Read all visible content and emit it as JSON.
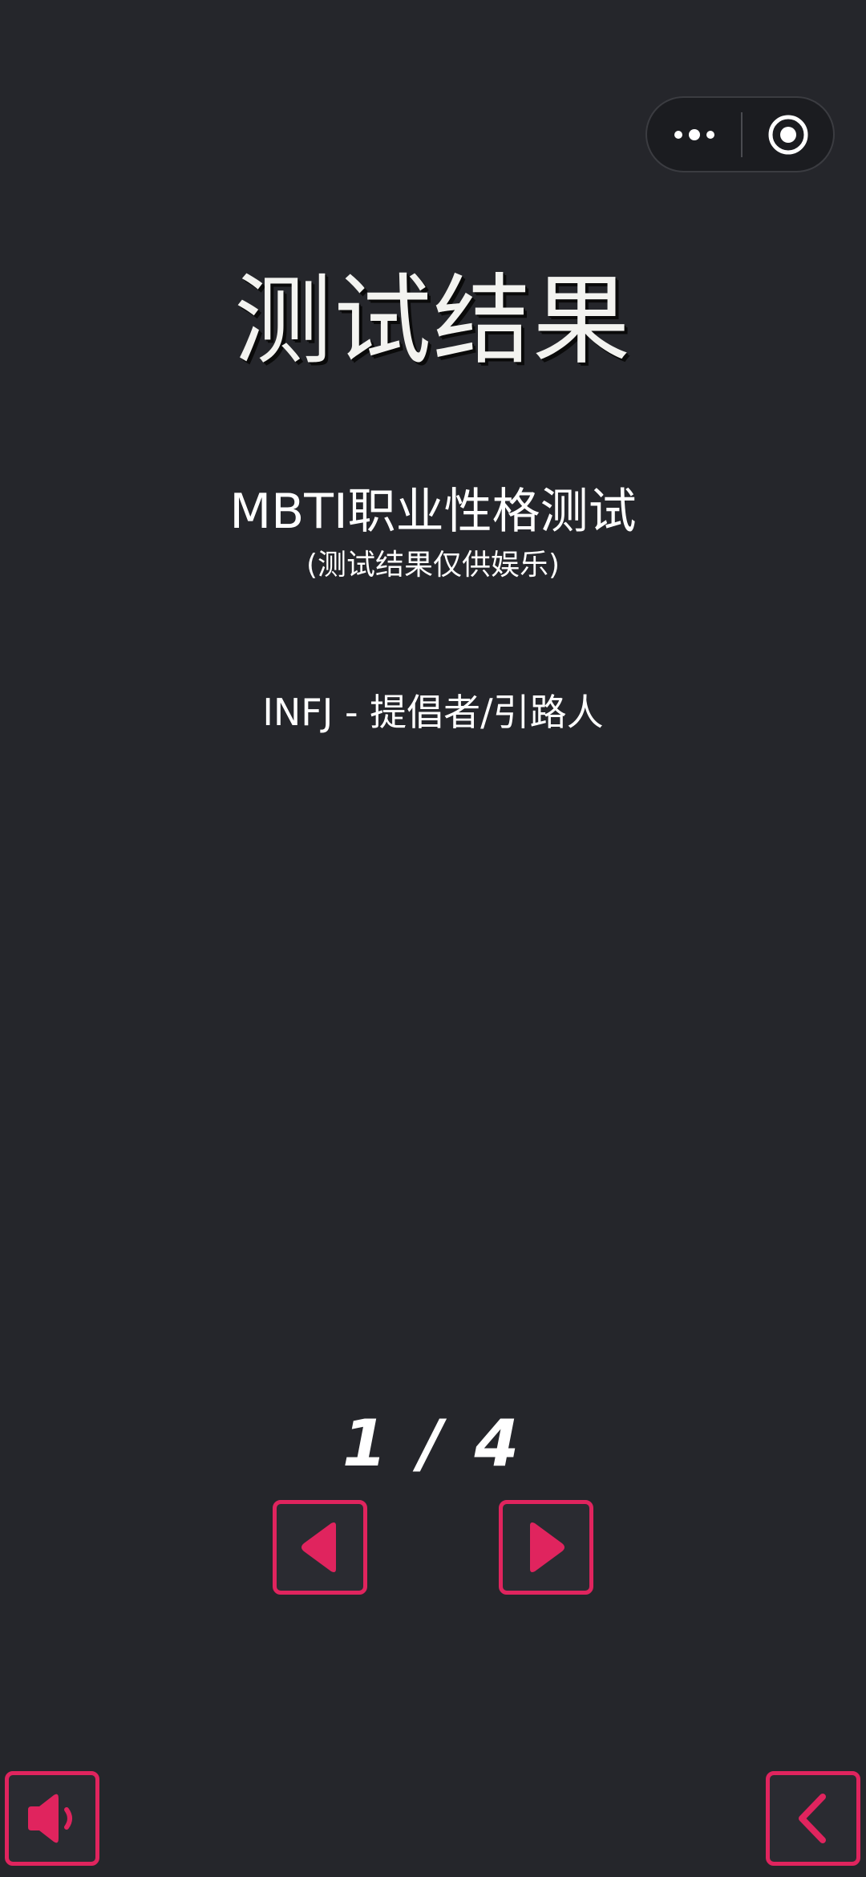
{
  "header": {
    "title": "测试结果",
    "capsule": {
      "more_icon": "more-dots-icon",
      "close_icon": "record-target-icon"
    }
  },
  "quiz": {
    "name": "MBTI职业性格测试",
    "note": "(测试结果仅供娱乐)",
    "result": "INFJ - 提倡者/引路人"
  },
  "pagination": {
    "current": 1,
    "total": 4,
    "label": "1 / 4"
  },
  "controls": {
    "prev_icon": "triangle-left-icon",
    "next_icon": "triangle-right-icon",
    "sound_icon": "speaker-icon",
    "back_icon": "chevron-left-icon"
  },
  "colors": {
    "background": "#25262b",
    "accent": "#e0245e",
    "text": "#ffffff"
  }
}
